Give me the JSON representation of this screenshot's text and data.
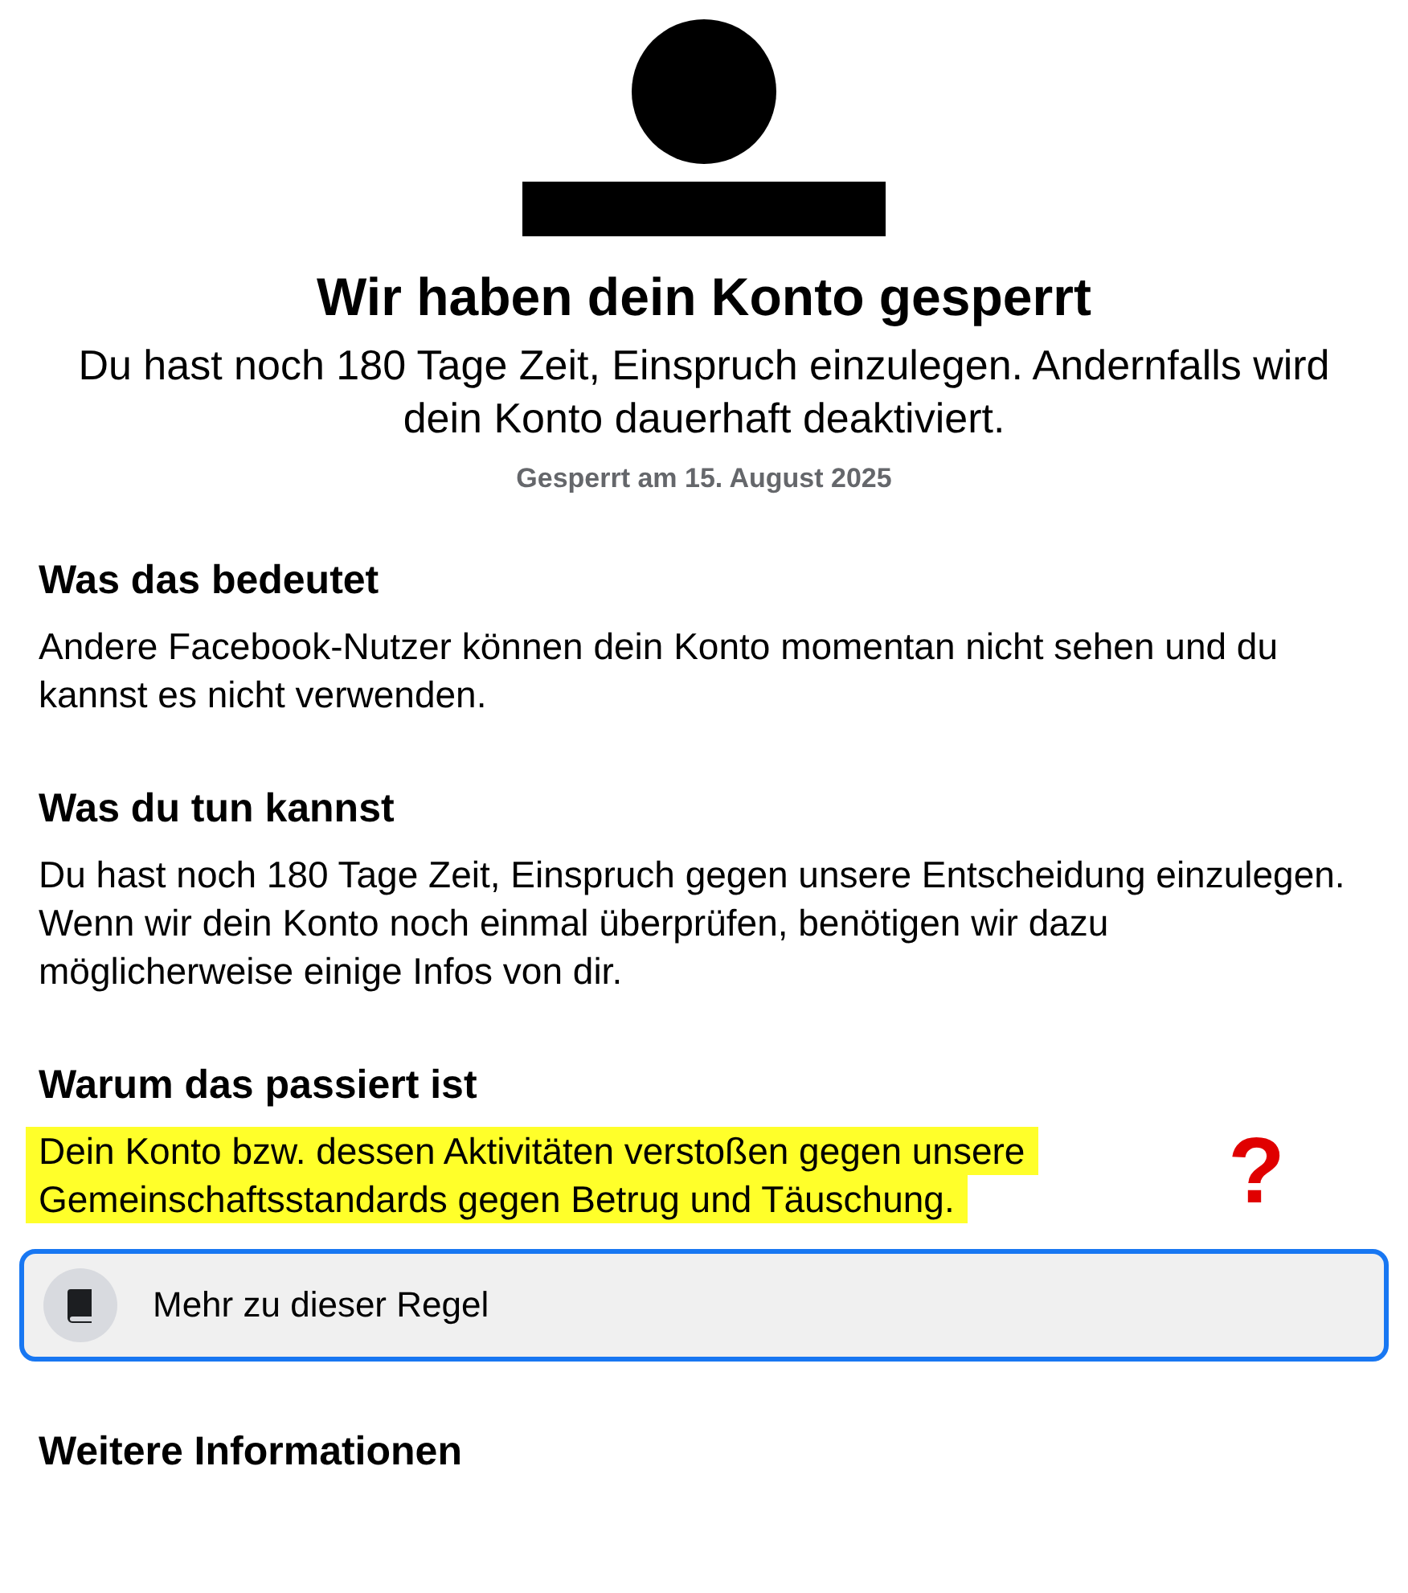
{
  "header": {
    "title": "Wir haben dein Konto gesperrt",
    "subtitle": "Du hast noch 180 Tage Zeit, Einspruch einzulegen. Andernfalls wird dein Konto dauerhaft deaktiviert.",
    "date": "Gesperrt am 15. August 2025"
  },
  "sections": [
    {
      "heading": "Was das bedeutet",
      "text": "Andere Facebook-Nutzer können dein Konto momentan nicht sehen und du kannst es nicht verwenden.",
      "highlighted": false
    },
    {
      "heading": "Was du tun kannst",
      "text": "Du hast noch 180 Tage Zeit, Einspruch gegen unsere Entscheidung einzulegen. Wenn wir dein Konto noch einmal überprüfen, benötigen wir dazu möglicherweise einige Infos von dir.",
      "highlighted": false
    },
    {
      "heading": "Warum das passiert ist",
      "text": "Dein Konto bzw. dessen Aktivitäten verstoßen gegen unsere Gemeinschaftsstandards gegen Betrug und Täuschung.",
      "highlighted": true,
      "annotation": "?",
      "button": {
        "label": "Mehr zu dieser Regel",
        "focused": true
      }
    },
    {
      "heading": "Weitere Informationen"
    }
  ]
}
